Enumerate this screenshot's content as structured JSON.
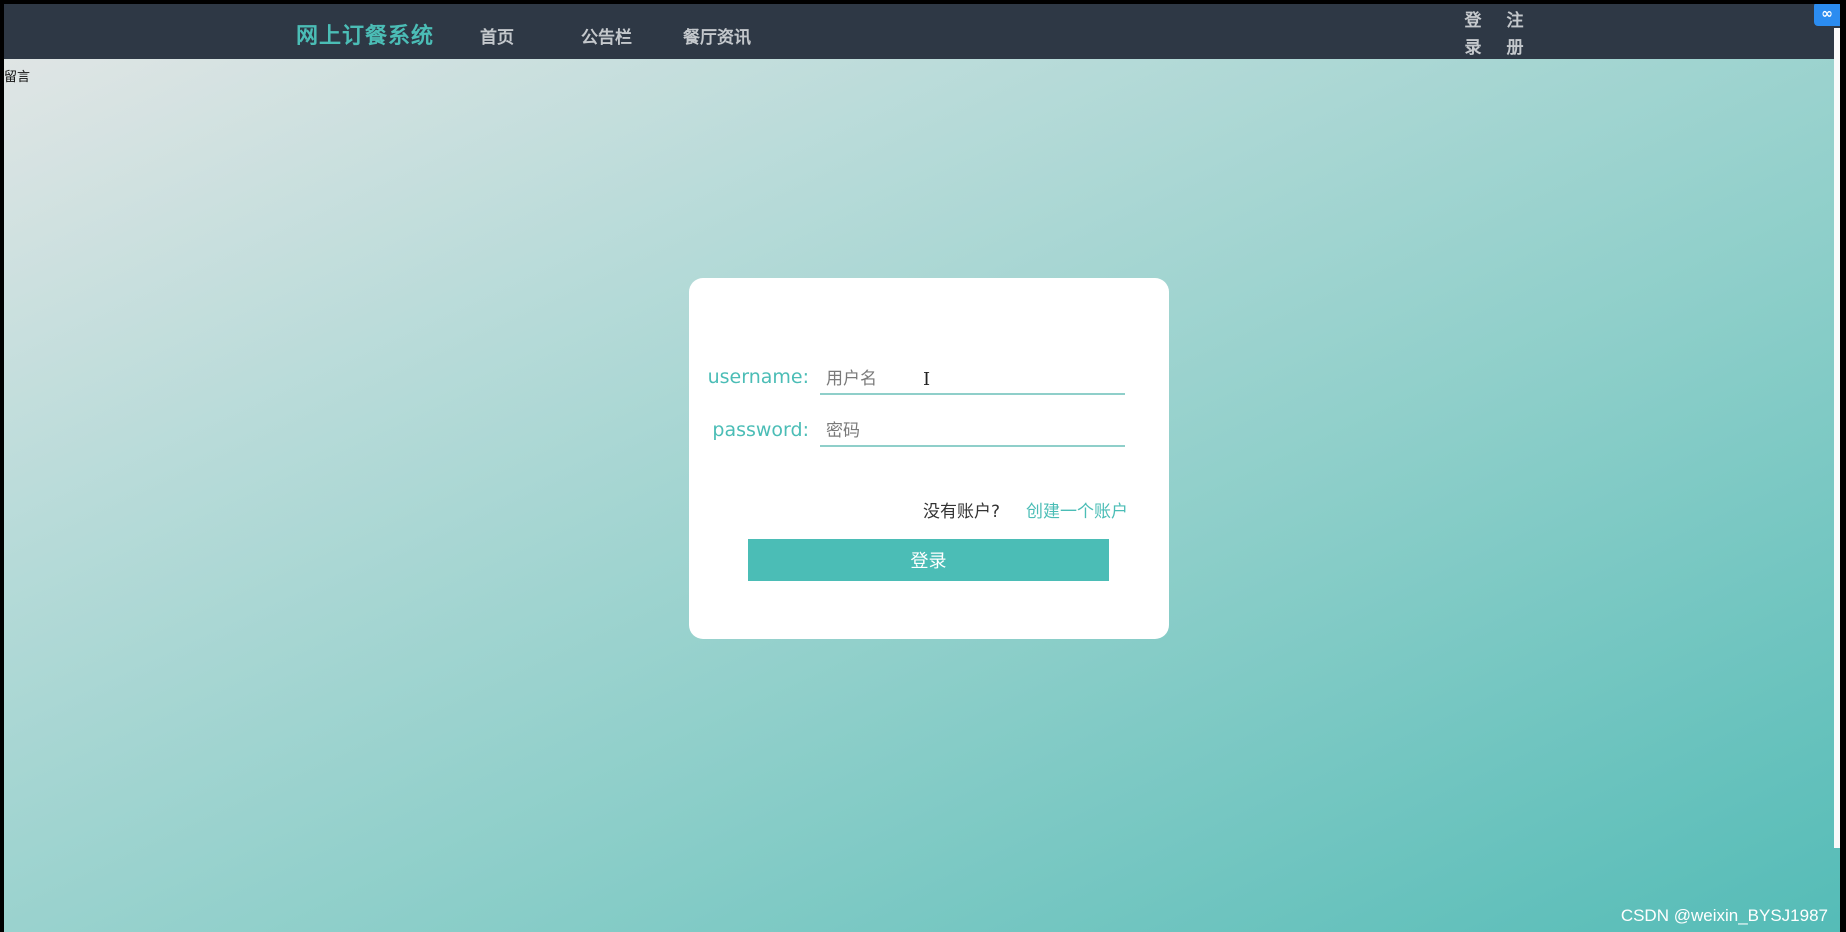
{
  "navbar": {
    "brand": "网上订餐系统",
    "links": {
      "home": "首页",
      "notice": "公告栏",
      "news": "餐厅资讯"
    },
    "login": "登录",
    "register": "注册"
  },
  "corner_text": "留言",
  "float_badge_icon": "link-icon",
  "login_form": {
    "username_label": "username:",
    "username_placeholder": "用户名",
    "password_label": "password:",
    "password_placeholder": "密码",
    "no_account_text": "没有账户?",
    "create_account_link": "创建一个账户",
    "login_button": "登录"
  },
  "watermark": "CSDN @weixin_BYSJ1987",
  "colors": {
    "accent": "#4bbdb6",
    "navbar_bg": "#2e3845"
  }
}
